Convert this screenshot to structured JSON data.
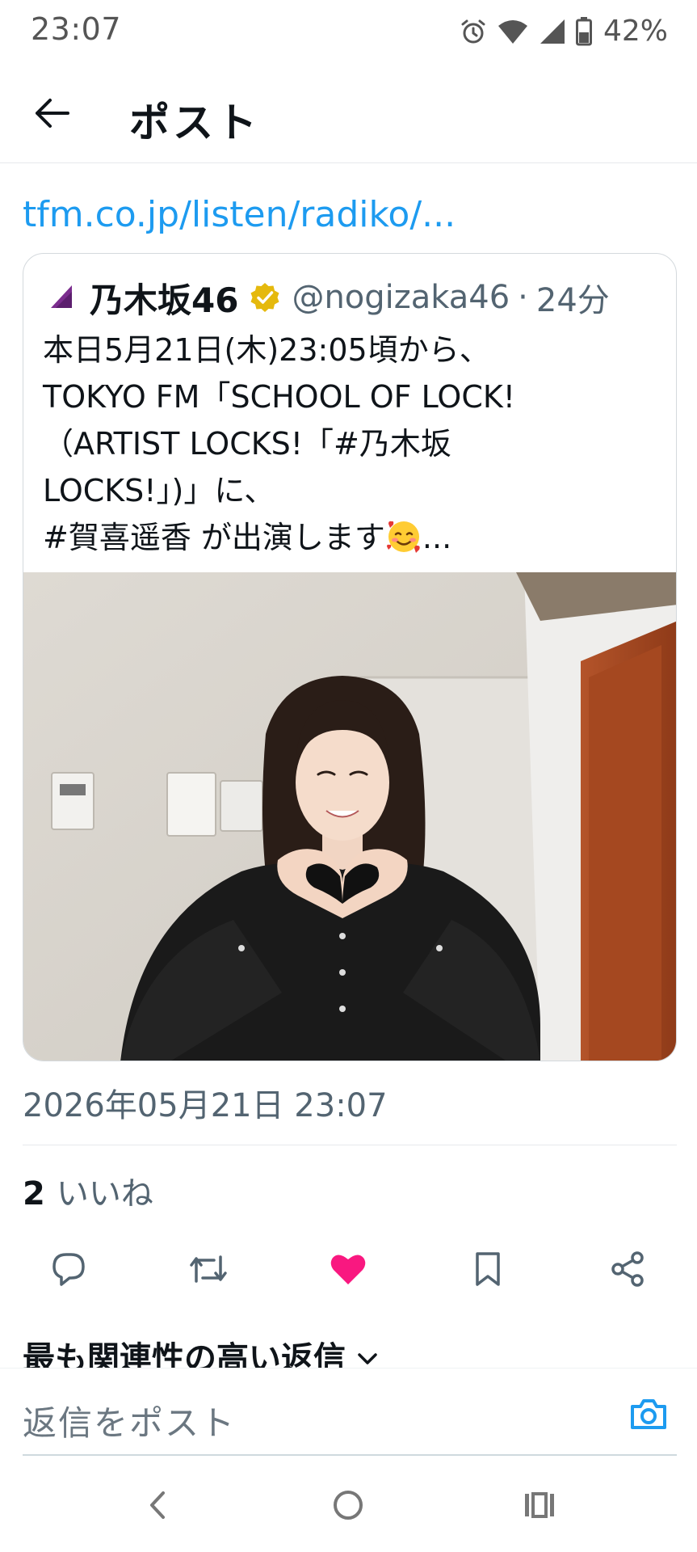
{
  "status_bar": {
    "time": "23:07",
    "battery": "42%",
    "icons": [
      "alarm-icon",
      "wifi-icon",
      "signal-icon",
      "battery-icon"
    ]
  },
  "header": {
    "title": "ポスト",
    "back_icon": "arrow-left-icon"
  },
  "post": {
    "link_text": "tfm.co.jp/listen/radiko/...",
    "quoted": {
      "author_name": "乃木坂46",
      "handle": "@nogizaka46",
      "separator": "·",
      "age": "24分",
      "body_lines": [
        "本日5月21日(木)23:05頃から、",
        "TOKYO FM「SCHOOL OF LOCK!",
        "（ARTIST LOCKS!「#乃木坂",
        "LOCKS!」)」に、"
      ],
      "last_line_start": "#賀喜遥香 が出演します",
      "last_line_end": "...",
      "emoji": "smiling-face-with-hearts-emoji",
      "verified_color": "#e5b90d"
    },
    "timestamp": "2026年05月21日 23:07",
    "likes_count": "2",
    "likes_label": "いいね",
    "like_color": "#f91880"
  },
  "actions": [
    "reply-icon",
    "repost-icon",
    "like-icon",
    "bookmark-icon",
    "share-icon"
  ],
  "replies_section": {
    "title": "最も関連性の高い返信"
  },
  "reply_bar": {
    "placeholder": "返信をポスト",
    "accent": "#1d9bf0"
  },
  "nav": [
    "back-nav-icon",
    "home-nav-icon",
    "recents-nav-icon"
  ]
}
